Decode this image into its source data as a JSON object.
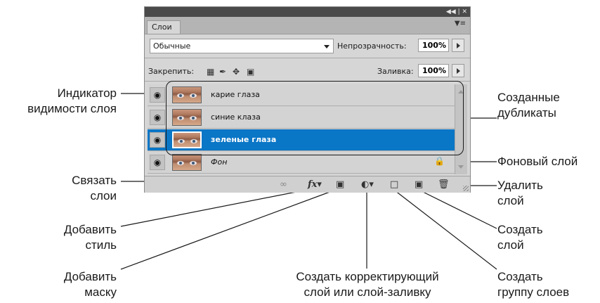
{
  "panel": {
    "window_controls": "◀◀ | ✕",
    "tab_label": "Слои",
    "menu_icon": "panel-menu-icon",
    "blend_mode": "Обычные",
    "opacity_label": "Непрозрачность:",
    "opacity_value": "100%",
    "lock_label": "Закрепить:",
    "fill_label": "Заливка:",
    "fill_value": "100%",
    "layers": [
      {
        "name": "карие глаза",
        "selected": false,
        "locked": false
      },
      {
        "name": "синие клаза",
        "selected": false,
        "locked": false
      },
      {
        "name": "зеленые глаза",
        "selected": true,
        "locked": false
      },
      {
        "name": "Фон",
        "selected": false,
        "locked": true
      }
    ],
    "bottom_icons": [
      "link-icon",
      "fx-icon",
      "mask-icon",
      "adjustment-icon",
      "folder-icon",
      "new-layer-icon",
      "trash-icon"
    ],
    "accent_color": "#0a76c6"
  },
  "annotations": {
    "visibility": [
      "Индикатор",
      "видимости слоя"
    ],
    "duplicates": [
      "Созданные",
      "дубликаты"
    ],
    "background": "Фоновый слой",
    "link": [
      "Связать",
      "слои"
    ],
    "delete": [
      "Удалить",
      "слой"
    ],
    "style": [
      "Добавить",
      "стиль"
    ],
    "create_layer": [
      "Создать",
      "слой"
    ],
    "mask": [
      "Добавить",
      "маску"
    ],
    "adjustment": [
      "Создать корректирующий",
      "слой или слой-заливку"
    ],
    "group": [
      "Создать",
      "группу слоев"
    ]
  }
}
